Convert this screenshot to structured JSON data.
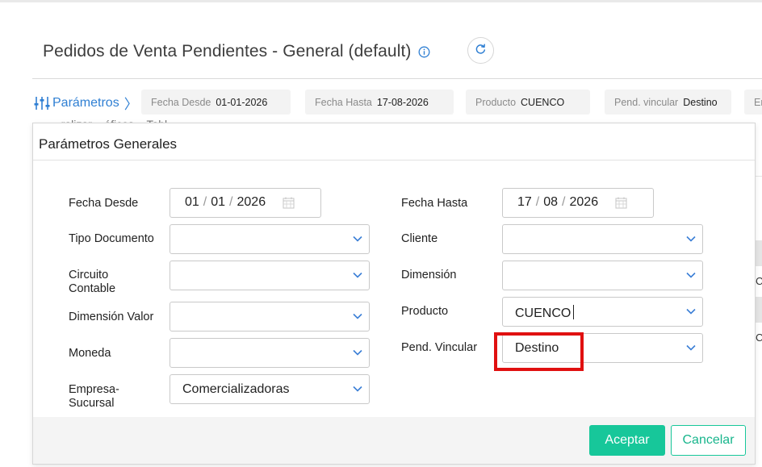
{
  "header": {
    "title": "Pedidos de Venta Pendientes - General (default)",
    "info_icon": "info-icon",
    "refresh_icon": "refresh-icon"
  },
  "params_bar": {
    "toggle_label": "Parámetros",
    "chevron": "〉",
    "chips": [
      {
        "label": "Fecha Desde",
        "value": "01-01-2026"
      },
      {
        "label": "Fecha Hasta",
        "value": "17-08-2026"
      },
      {
        "label": "Producto",
        "value": "CUENCO"
      },
      {
        "label": "Pend. vincular",
        "value": "Destino"
      },
      {
        "label": "Em",
        "value": ""
      }
    ]
  },
  "background": {
    "tabs_fragment": "...ralizar   ...áficos   ...Tabl...",
    "row_c1": "C",
    "row_c2": "C"
  },
  "modal": {
    "title": "Parámetros Generales",
    "fields": {
      "fecha_desde": {
        "label": "Fecha Desde",
        "day": "01",
        "month": "01",
        "year": "2026"
      },
      "fecha_hasta": {
        "label": "Fecha Hasta",
        "day": "17",
        "month": "08",
        "year": "2026"
      },
      "tipo_documento": {
        "label": "Tipo Documento",
        "value": ""
      },
      "cliente": {
        "label": "Cliente",
        "value": ""
      },
      "circuito_contable": {
        "label_line1": "Circuito",
        "label_line2": "Contable",
        "value": ""
      },
      "dimension": {
        "label": "Dimensión",
        "value": ""
      },
      "dimension_valor": {
        "label": "Dimensión Valor",
        "value": ""
      },
      "producto": {
        "label": "Producto",
        "value": "CUENCO"
      },
      "moneda": {
        "label": "Moneda",
        "value": ""
      },
      "pend_vincular": {
        "label": "Pend. Vincular",
        "value": "Destino"
      },
      "empresa_sucursal": {
        "label_line1": "Empresa-",
        "label_line2": "Sucursal",
        "value": "Comercializadoras"
      }
    },
    "buttons": {
      "accept": "Aceptar",
      "cancel": "Cancelar"
    }
  },
  "colors": {
    "accent_blue": "#2f7fd3",
    "accept_green": "#17c79a",
    "highlight_red": "#e01010"
  }
}
